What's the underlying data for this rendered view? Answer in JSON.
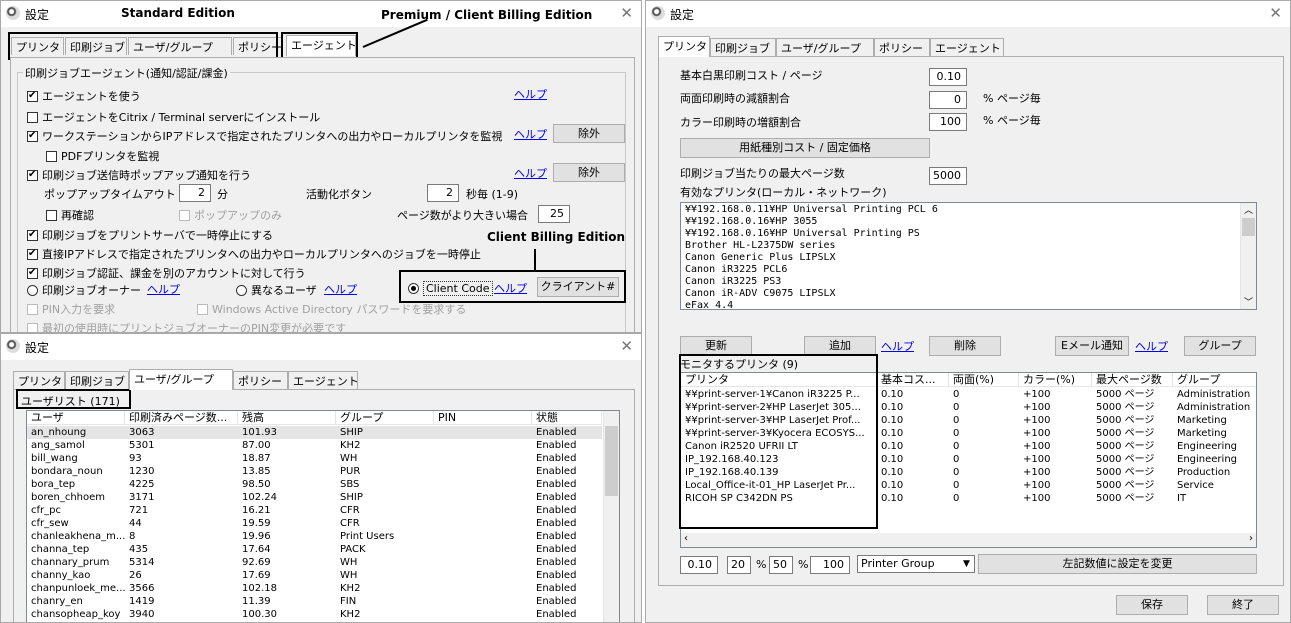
{
  "window_title": "設定",
  "annotations": {
    "standard": "Standard Edition",
    "premium": "Premium / Client Billing Edition",
    "client_billing": "Client Billing Edition"
  },
  "tabs": [
    "プリンタ",
    "印刷ジョブ",
    "ユーザ/グループ",
    "ポリシー",
    "エージェント"
  ],
  "agent": {
    "group_label": "印刷ジョブエージェント(通知/認証/課金)",
    "use_agent": "エージェントを使う",
    "citrix": "エージェントをCitrix / Terminal serverにインストール",
    "monitor_ws": "ワークステーションからIPアドレスで指定されたプリンタへの出力やローカルプリンタを監視",
    "pdf_monitor": "PDFプリンタを監視",
    "popup_notify": "印刷ジョブ送信時ポップアップ通知を行う",
    "popup_timeout_label": "ポップアップタイムアウト",
    "popup_timeout_value": "2",
    "popup_timeout_unit": "分",
    "activate_btn_label": "活動化ボタン",
    "activate_value": "2",
    "activate_unit": "秒毎 (1-9)",
    "reconfirm": "再確認",
    "popup_only": "ポップアップのみ",
    "pages_greater": "ページ数がより大きい場合",
    "pages_value": "25",
    "pause_server": "印刷ジョブをプリントサーバで一時停止にする",
    "pause_direct": "直接IPアドレスで指定されたプリンタへの出力やローカルプリンタへのジョブを一時停止",
    "auth_billing": "印刷ジョブ認証、課金を別のアカウントに対して行う",
    "owner": "印刷ジョブオーナー",
    "diff_user": "異なるユーザ",
    "client_code": "Client Code",
    "client_btn": "クライアント#",
    "pin_required": "PIN入力を要求",
    "windows_ad": "Windows Active Directory パスワードを要求する",
    "first_use": "最初の使用時にプリントジョブオーナーのPIN変更が必要です",
    "help": "ヘルプ",
    "exclude": "除外"
  },
  "users": {
    "list_label": "ユーザリスト (171)",
    "columns": [
      "ユーザ",
      "印刷済みページ数...",
      "残高",
      "グループ",
      "PIN",
      "状態"
    ],
    "rows": [
      [
        "an_nhoung",
        "3063",
        "101.93",
        "SHIP",
        "",
        "Enabled"
      ],
      [
        "ang_samol",
        "5301",
        "87.00",
        "KH2",
        "",
        "Enabled"
      ],
      [
        "bill_wang",
        "93",
        "18.87",
        "WH",
        "",
        "Enabled"
      ],
      [
        "bondara_noun",
        "1230",
        "13.85",
        "PUR",
        "",
        "Enabled"
      ],
      [
        "bora_tep",
        "4225",
        "98.50",
        "SBS",
        "",
        "Enabled"
      ],
      [
        "boren_chhoem",
        "3171",
        "102.24",
        "SHIP",
        "",
        "Enabled"
      ],
      [
        "cfr_pc",
        "721",
        "16.21",
        "CFR",
        "",
        "Enabled"
      ],
      [
        "cfr_sew",
        "44",
        "19.59",
        "CFR",
        "",
        "Enabled"
      ],
      [
        "chanleakhena_m...",
        "8",
        "19.96",
        "Print Users",
        "",
        "Enabled"
      ],
      [
        "channa_tep",
        "435",
        "17.64",
        "PACK",
        "",
        "Enabled"
      ],
      [
        "channary_prum",
        "5314",
        "92.69",
        "WH",
        "",
        "Enabled"
      ],
      [
        "channy_kao",
        "26",
        "17.69",
        "WH",
        "",
        "Enabled"
      ],
      [
        "chanpunloek_me...",
        "3566",
        "102.18",
        "KH2",
        "",
        "Enabled"
      ],
      [
        "chanry_en",
        "1419",
        "11.39",
        "FIN",
        "",
        "Enabled"
      ],
      [
        "chansopheap_koy",
        "3940",
        "100.30",
        "KH2",
        "",
        "Enabled"
      ]
    ]
  },
  "printer": {
    "bw_cost_label": "基本白黒印刷コスト / ページ",
    "bw_cost": "0.10",
    "duplex_label": "両面印刷時の減額割合",
    "duplex": "0",
    "duplex_unit": "% ページ毎",
    "color_label": "カラー印刷時の増額割合",
    "color": "100",
    "color_unit": "% ページ毎",
    "paper_btn": "用紙種別コスト / 固定価格",
    "max_pages_label": "印刷ジョブ当たりの最大ページ数",
    "max_pages": "5000",
    "valid_label": "有効なプリンタ(ローカル・ネットワーク)",
    "valid_printers": [
      "¥¥192.168.0.11¥HP Universal Printing PCL 6",
      "¥¥192.168.0.16¥HP 3055",
      "¥¥192.168.0.16¥HP Universal Printing PS",
      "Brother HL-L2375DW series",
      "Canon Generic Plus LIPSLX",
      "Canon iR3225 PCL6",
      "Canon iR3225 PS3",
      "Canon iR-ADV C9075 LIPSLX",
      "eFax 4.4"
    ],
    "refresh_btn": "更新",
    "add_btn": "追加",
    "delete_btn": "削除",
    "email_btn": "Eメール通知",
    "group_btn": "グループ",
    "monitored_label": "モニタするプリンタ (9)",
    "columns": [
      "プリンタ",
      "基本コス...",
      "両面(%)",
      "カラー(%)",
      "最大ページ数",
      "グループ"
    ],
    "rows": [
      [
        "¥¥print-server-1¥Canon iR3225 P...",
        "0.10",
        "0",
        "+100",
        "5000 ページ",
        "Administration"
      ],
      [
        "¥¥print-server-2¥HP LaserJet 305...",
        "0.10",
        "0",
        "+100",
        "5000 ページ",
        "Administration"
      ],
      [
        "¥¥print-server-3¥HP LaserJet Prof...",
        "0.10",
        "0",
        "+100",
        "5000 ページ",
        "Marketing"
      ],
      [
        "¥¥print-server-3¥Kyocera ECOSYS...",
        "0.10",
        "0",
        "+100",
        "5000 ページ",
        "Marketing"
      ],
      [
        "Canon iR2520 UFRII LT",
        "0.10",
        "0",
        "+100",
        "5000 ページ",
        "Engineering"
      ],
      [
        "IP_192.168.40.123",
        "0.10",
        "0",
        "+100",
        "5000 ページ",
        "Engineering"
      ],
      [
        "IP_192.168.40.139",
        "0.10",
        "0",
        "+100",
        "5000 ページ",
        "Production"
      ],
      [
        "Local_Office-it-01_HP LaserJet Pr...",
        "0.10",
        "0",
        "+100",
        "5000 ページ",
        "Service"
      ],
      [
        "RICOH SP C342DN PS",
        "0.10",
        "0",
        "+100",
        "5000 ページ",
        "IT"
      ]
    ],
    "bottom_cost": "0.10",
    "bottom_duplex": "20",
    "bottom_color": "50",
    "bottom_max": "100",
    "pct": "%",
    "group_select": "Printer Group",
    "apply_btn": "左記数値に設定を変更",
    "save_btn": "保存",
    "exit_btn": "終了"
  }
}
